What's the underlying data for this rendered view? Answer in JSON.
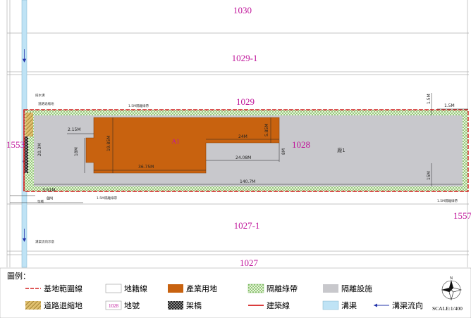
{
  "parcels": {
    "p1030": "1030",
    "p1029_1": "1029-1",
    "p1029": "1029",
    "p1028": "1028",
    "p1553": "1553",
    "p1557": "1557",
    "p1027_1": "1027-1",
    "p1027": "1027"
  },
  "labels": {
    "building_code": "A1",
    "facility": "廠1",
    "drain_note": "排水溝",
    "boundary_note": "道路退縮地",
    "green_top_note": "1.5M隔離綠帶",
    "green_bottom_left_note": "1.5M隔離綠帶",
    "green_bottom_right_note": "1.5M隔離綠帶",
    "bridge_note": "架橋",
    "flow_note": "溝渠流向示意"
  },
  "dimensions": {
    "d_2_15": "2.15M",
    "d_18": "18M",
    "d_19_85": "19.85M",
    "d_36_75": "36.75M",
    "d_24": "24M",
    "d_5_85": "5.85M",
    "d_24_08": "24.08M",
    "d_8m_small": "8M",
    "d_140_7": "140.7M",
    "d_15m_right": "15M",
    "d_1_5_right": "1.5M",
    "d_1_5_top": "1.5M",
    "d_3_51": "3.51M",
    "d_8m": "8M",
    "d_left_vert": "20.3M"
  },
  "legend": {
    "title": "圖例：",
    "items": [
      {
        "id": "boundary",
        "label": "基地範圍線"
      },
      {
        "id": "cadastral",
        "label": "地籍線"
      },
      {
        "id": "industrial",
        "label": "產業用地"
      },
      {
        "id": "buffer",
        "label": "隔離綠帶"
      },
      {
        "id": "isolation",
        "label": "隔離設施"
      },
      {
        "id": "setback",
        "label": "道路退縮地"
      },
      {
        "id": "lotno",
        "label": "地號",
        "sample": "1028"
      },
      {
        "id": "bridge",
        "label": "架橋"
      },
      {
        "id": "buildline",
        "label": "建築線"
      },
      {
        "id": "ditch",
        "label": "溝渠"
      },
      {
        "id": "flow",
        "label": "溝渠流向"
      }
    ]
  },
  "scale": "SCALE:1/400",
  "colors": {
    "parcel_text": "#c0169b",
    "industrial": "#c8620f",
    "isolation": "#c8c8cc",
    "buffer": "#7cc04a",
    "boundary": "#d42020",
    "ditch": "#bfe3f5",
    "flow": "#2233aa"
  }
}
